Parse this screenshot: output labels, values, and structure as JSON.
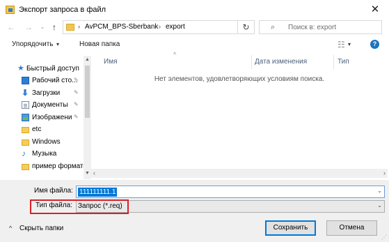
{
  "window": {
    "title": "Экспорт запроса в файл",
    "close_glyph": "✕"
  },
  "nav": {
    "back_glyph": "←",
    "forward_glyph": "→",
    "recent_glyph": "⌄",
    "up_glyph": "↑",
    "refresh_glyph": "↻"
  },
  "address": {
    "segments": [
      "AvPCM_BPS-Sberbank",
      "export"
    ],
    "separator": "›",
    "dropdown_glyph": "⌄"
  },
  "search": {
    "placeholder": "Поиск в: export",
    "icon_glyph": "⌕"
  },
  "toolbar": {
    "organize_label": "Упорядочить",
    "organize_arrow": "▾",
    "new_folder_label": "Новая папка",
    "view_glyph": "☷",
    "view_arrow": "▾",
    "help_glyph": "?"
  },
  "sidebar": {
    "pin_glyph": "✎",
    "items": [
      {
        "label": "Быстрый доступ",
        "icon": "star-icon",
        "pinned": false
      },
      {
        "label": "Рабочий сто...",
        "icon": "desktop-icon",
        "pinned": true
      },
      {
        "label": "Загрузки",
        "icon": "download-icon",
        "pinned": true
      },
      {
        "label": "Документы",
        "icon": "documents-icon",
        "pinned": true
      },
      {
        "label": "Изображени",
        "icon": "pictures-icon",
        "pinned": true
      },
      {
        "label": "etc",
        "icon": "folder-icon",
        "pinned": false
      },
      {
        "label": "Windows",
        "icon": "folder-icon",
        "pinned": false
      },
      {
        "label": "Музыка",
        "icon": "music-icon",
        "pinned": false
      },
      {
        "label": "пример форматс",
        "icon": "folder-icon",
        "pinned": false
      }
    ]
  },
  "filelist": {
    "sort_caret": "^",
    "columns": [
      "Имя",
      "Дата изменения",
      "Тип"
    ],
    "empty_message": "Нет элементов, удовлетворяющих условиям поиска.",
    "scroll_left_glyph": "‹",
    "scroll_right_glyph": "›"
  },
  "form": {
    "filename_label": "Имя файла:",
    "filename_value": "111111111.1",
    "filetype_label": "Тип файла:",
    "filetype_value": "Запрос (*.req)",
    "dropdown_glyph": "⌄"
  },
  "footer": {
    "collapse_glyph": "^",
    "collapse_label": "Скрыть папки",
    "save_label": "Сохранить",
    "cancel_label": "Отмена"
  },
  "colors": {
    "accent": "#0078d7",
    "highlight_border": "#d9202a",
    "folder": "#f6cd58"
  }
}
